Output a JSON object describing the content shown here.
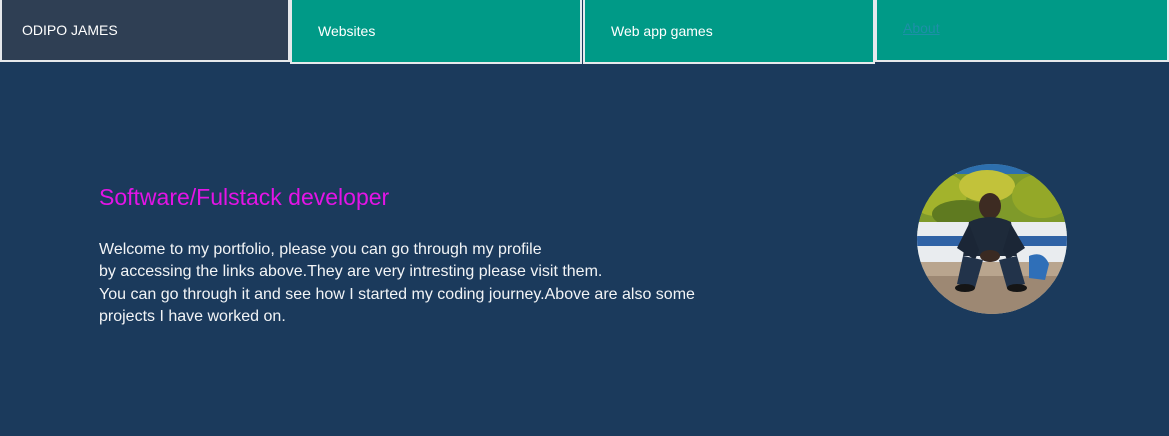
{
  "nav": {
    "brand": "ODIPO JAMES",
    "websites_label": "Websites",
    "games_label": "Web app games",
    "about_label": "About"
  },
  "hero": {
    "heading": "Software/Fulstack developer",
    "intro_lines": [
      "Welcome to my portfolio, please you can go through my profile",
      "by accessing the links above.They are very intresting please visit them.",
      "You can go through it and see how I started my coding journey.Above are also some",
      "projects I have worked on."
    ]
  },
  "colors": {
    "page_background": "#1b3a5c",
    "nav_accent": "#009a87",
    "brand_background": "#2f3f54",
    "heading": "#e314e6"
  }
}
